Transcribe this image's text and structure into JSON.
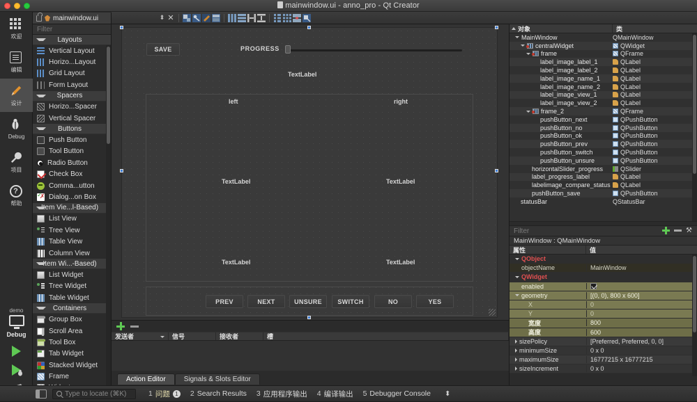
{
  "window": {
    "title": "mainwindow.ui - anno_pro - Qt Creator",
    "file_tab": "mainwindow.ui"
  },
  "modebar": {
    "items": [
      {
        "label": "欢迎",
        "icon": "welcome-grid-icon"
      },
      {
        "label": "编辑",
        "icon": "edit-document-icon"
      },
      {
        "label": "设计",
        "icon": "design-pencil-icon"
      },
      {
        "label": "Debug",
        "icon": "debug-bug-icon"
      },
      {
        "label": "项目",
        "icon": "projects-wrench-icon"
      },
      {
        "label": "帮助",
        "icon": "help-question-icon"
      }
    ],
    "run": {
      "kit_name": "demo",
      "build_config": "Debug",
      "run_icon": "run-play-icon",
      "debug_icon": "debug-play-icon",
      "build_icon": "build-hammer-icon"
    }
  },
  "widget_box": {
    "filter_placeholder": "Filter",
    "groups": [
      {
        "name": "Layouts",
        "items": [
          {
            "label": "Vertical Layout",
            "icon": "vertical-layout-icon"
          },
          {
            "label": "Horizo...Layout",
            "icon": "horizontal-layout-icon"
          },
          {
            "label": "Grid Layout",
            "icon": "grid-layout-icon"
          },
          {
            "label": "Form Layout",
            "icon": "form-layout-icon"
          }
        ]
      },
      {
        "name": "Spacers",
        "items": [
          {
            "label": "Horizo...Spacer",
            "icon": "horizontal-spacer-icon"
          },
          {
            "label": "Vertical Spacer",
            "icon": "vertical-spacer-icon"
          }
        ]
      },
      {
        "name": "Buttons",
        "items": [
          {
            "label": "Push Button",
            "icon": "push-button-icon"
          },
          {
            "label": "Tool Button",
            "icon": "tool-button-icon"
          },
          {
            "label": "Radio Button",
            "icon": "radio-button-icon"
          },
          {
            "label": "Check Box",
            "icon": "check-box-icon"
          },
          {
            "label": "Comma...utton",
            "icon": "command-link-button-icon"
          },
          {
            "label": "Dialog...on Box",
            "icon": "dialog-button-box-icon"
          }
        ]
      },
      {
        "name": "Item Vie...l-Based)",
        "items": [
          {
            "label": "List View",
            "icon": "list-view-icon"
          },
          {
            "label": "Tree View",
            "icon": "tree-view-icon"
          },
          {
            "label": "Table View",
            "icon": "table-view-icon"
          },
          {
            "label": "Column View",
            "icon": "column-view-icon"
          }
        ]
      },
      {
        "name": "Item Wi...-Based)",
        "items": [
          {
            "label": "List Widget",
            "icon": "list-widget-icon"
          },
          {
            "label": "Tree Widget",
            "icon": "tree-widget-icon"
          },
          {
            "label": "Table Widget",
            "icon": "table-widget-icon"
          }
        ]
      },
      {
        "name": "Containers",
        "items": [
          {
            "label": "Group Box",
            "icon": "group-box-icon"
          },
          {
            "label": "Scroll Area",
            "icon": "scroll-area-icon"
          },
          {
            "label": "Tool Box",
            "icon": "tool-box-icon"
          },
          {
            "label": "Tab Widget",
            "icon": "tab-widget-icon"
          },
          {
            "label": "Stacked Widget",
            "icon": "stacked-widget-icon"
          },
          {
            "label": "Frame",
            "icon": "frame-icon"
          },
          {
            "label": "Widget",
            "icon": "widget-icon"
          }
        ]
      }
    ]
  },
  "canvas": {
    "save_button": "SAVE",
    "progress_label": "PROGRESS",
    "status_label": "TextLabel",
    "name_left": "left",
    "name_right": "right",
    "view_left": "TextLabel",
    "view_right": "TextLabel",
    "label_left": "TextLabel",
    "label_right": "TextLabel",
    "buttons": [
      "PREV",
      "NEXT",
      "UNSURE",
      "SWITCH",
      "NO",
      "YES"
    ]
  },
  "signals_editor": {
    "columns": [
      "发送者",
      "信号",
      "接收者",
      "槽"
    ],
    "tabs": [
      {
        "label": "Action Editor",
        "active": true
      },
      {
        "label": "Signals & Slots Editor",
        "active": false
      }
    ]
  },
  "object_tree": {
    "headers": [
      "对象",
      "类"
    ],
    "rows": [
      {
        "name": "MainWindow",
        "cls": "QMainWindow",
        "indent": 1,
        "expander": true,
        "icon": "none"
      },
      {
        "name": "centralWidget",
        "cls": "QWidget",
        "indent": 2,
        "expander": true,
        "icon": "form-icon"
      },
      {
        "name": "frame",
        "cls": "QFrame",
        "indent": 3,
        "expander": true,
        "icon": "form-icon"
      },
      {
        "name": "label_image_label_1",
        "cls": "QLabel",
        "indent": 5,
        "expander": false,
        "icon": "label-icon"
      },
      {
        "name": "label_image_label_2",
        "cls": "QLabel",
        "indent": 5,
        "expander": false,
        "icon": "label-icon"
      },
      {
        "name": "label_image_name_1",
        "cls": "QLabel",
        "indent": 5,
        "expander": false,
        "icon": "label-icon"
      },
      {
        "name": "label_image_name_2",
        "cls": "QLabel",
        "indent": 5,
        "expander": false,
        "icon": "label-icon"
      },
      {
        "name": "label_image_view_1",
        "cls": "QLabel",
        "indent": 5,
        "expander": false,
        "icon": "label-icon"
      },
      {
        "name": "label_image_view_2",
        "cls": "QLabel",
        "indent": 5,
        "expander": false,
        "icon": "label-icon"
      },
      {
        "name": "frame_2",
        "cls": "QFrame",
        "indent": 3,
        "expander": true,
        "icon": "form-icon"
      },
      {
        "name": "pushButton_next",
        "cls": "QPushButton",
        "indent": 5,
        "expander": false,
        "icon": "button-icon"
      },
      {
        "name": "pushButton_no",
        "cls": "QPushButton",
        "indent": 5,
        "expander": false,
        "icon": "button-icon"
      },
      {
        "name": "pushButton_ok",
        "cls": "QPushButton",
        "indent": 5,
        "expander": false,
        "icon": "button-icon"
      },
      {
        "name": "pushButton_prev",
        "cls": "QPushButton",
        "indent": 5,
        "expander": false,
        "icon": "button-icon"
      },
      {
        "name": "pushButton_switch",
        "cls": "QPushButton",
        "indent": 5,
        "expander": false,
        "icon": "button-icon"
      },
      {
        "name": "pushButton_unsure",
        "cls": "QPushButton",
        "indent": 5,
        "expander": false,
        "icon": "button-icon"
      },
      {
        "name": "horizontalSlider_progress",
        "cls": "QSlider",
        "indent": 4,
        "expander": false,
        "icon": "slider-icon"
      },
      {
        "name": "label_progress_label",
        "cls": "QLabel",
        "indent": 4,
        "expander": false,
        "icon": "label-icon"
      },
      {
        "name": "labelimage_compare_status",
        "cls": "QLabel",
        "indent": 4,
        "expander": false,
        "icon": "label-icon"
      },
      {
        "name": "pushButton_save",
        "cls": "QPushButton",
        "indent": 4,
        "expander": false,
        "icon": "button-icon"
      },
      {
        "name": "statusBar",
        "cls": "QStatusBar",
        "indent": 2,
        "expander": false,
        "icon": "none"
      }
    ]
  },
  "property_editor": {
    "filter_placeholder": "Filter",
    "object_line": "MainWindow : QMainWindow",
    "headers": [
      "属性",
      "值"
    ],
    "rows": [
      {
        "name": "QObject",
        "value": "",
        "style": "grp",
        "expander": "down",
        "indent": 0
      },
      {
        "name": "objectName",
        "value": "MainWindow",
        "style": "dark",
        "expander": "none",
        "indent": 1
      },
      {
        "name": "QWidget",
        "value": "",
        "style": "grp",
        "expander": "down",
        "indent": 0
      },
      {
        "name": "enabled",
        "value": "",
        "style": "hi",
        "expander": "none",
        "indent": 1,
        "checkbox": true
      },
      {
        "name": "geometry",
        "value": "[(0, 0), 800 x 600]",
        "style": "hi",
        "expander": "down",
        "indent": 0
      },
      {
        "name": "X",
        "value": "0",
        "style": "sub",
        "expander": "none",
        "indent": 2
      },
      {
        "name": "Y",
        "value": "0",
        "style": "sub",
        "expander": "none",
        "indent": 2
      },
      {
        "name": "宽度",
        "value": "800",
        "style": "hi2",
        "expander": "none",
        "indent": 2
      },
      {
        "name": "高度",
        "value": "600",
        "style": "hi2",
        "expander": "none",
        "indent": 2
      },
      {
        "name": "sizePolicy",
        "value": "[Preferred, Preferred, 0, 0]",
        "style": "nrm",
        "expander": "right",
        "indent": 0
      },
      {
        "name": "minimumSize",
        "value": "0 x 0",
        "style": "nrm2",
        "expander": "right",
        "indent": 0
      },
      {
        "name": "maximumSize",
        "value": "16777215 x 16777215",
        "style": "nrm",
        "expander": "right",
        "indent": 0
      },
      {
        "name": "sizeIncrement",
        "value": "0 x 0",
        "style": "nrm2",
        "expander": "right",
        "indent": 0
      }
    ]
  },
  "status_bar": {
    "locate_placeholder": "Type to locate (⌘K)",
    "items": [
      {
        "num": "1",
        "label": "问题",
        "badge": "1",
        "warn": true
      },
      {
        "num": "2",
        "label": "Search Results",
        "badge": "",
        "warn": false
      },
      {
        "num": "3",
        "label": "应用程序输出",
        "badge": "",
        "warn": false
      },
      {
        "num": "4",
        "label": "编译输出",
        "badge": "",
        "warn": false
      },
      {
        "num": "5",
        "label": "Debugger Console",
        "badge": "",
        "warn": false
      }
    ]
  },
  "colors": {
    "accent": "#3f7fd8",
    "green": "#5fc954",
    "property_highlight": "#7a7a52",
    "group_red": "#e05050"
  }
}
